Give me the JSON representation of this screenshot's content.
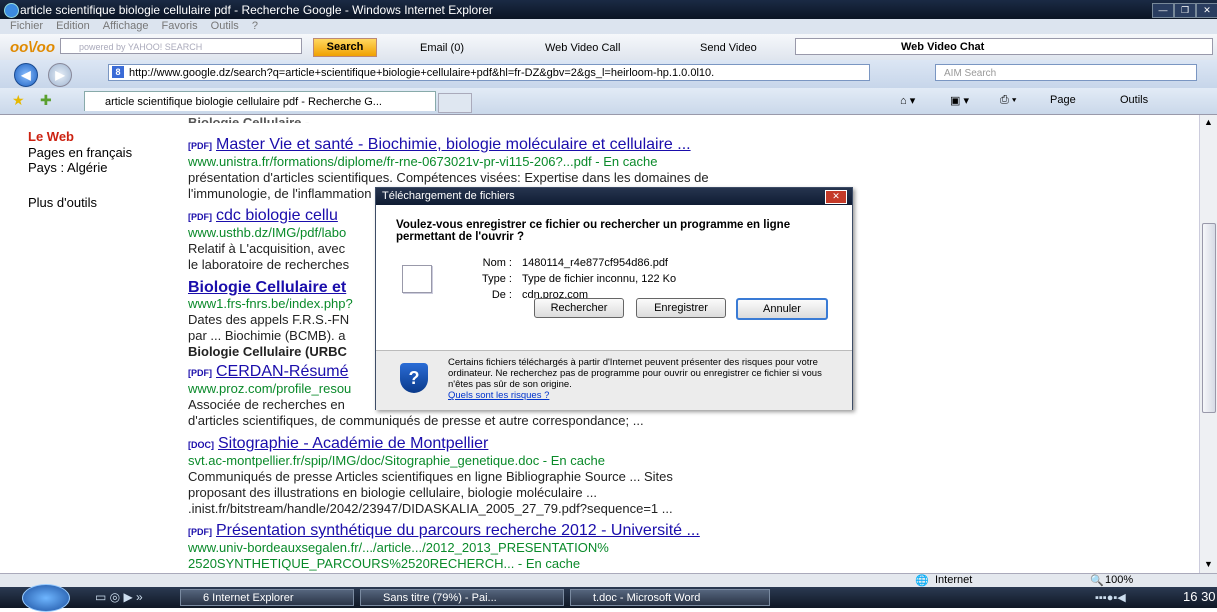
{
  "window": {
    "title": "article scientifique biologie cellulaire pdf - Recherche Google - Windows Internet Explorer"
  },
  "menu": [
    "Fichier",
    "Edition",
    "Affichage",
    "Favoris",
    "Outils",
    "?"
  ],
  "yahoo_toolbar": {
    "logo": "oo\\/oo",
    "search_placeholder": "powered by YAHOO! SEARCH",
    "search_button": "Search",
    "email": "Email (0)",
    "video_call": "Web Video Call",
    "send_video": "Send Video",
    "video_chat": "Web Video Chat"
  },
  "address_bar": {
    "url": "http://www.google.dz/search?q=article+scientifique+biologie+cellulaire+pdf&hl=fr-DZ&gbv=2&gs_l=heirloom-hp.1.0.0l10.",
    "aim_placeholder": "AIM Search"
  },
  "tab": {
    "label": "article scientifique biologie cellulaire pdf - Recherche G..."
  },
  "commands": {
    "page": "Page",
    "tools": "Outils"
  },
  "left_nav": {
    "web": "Le Web",
    "pages_fr": "Pages en français",
    "country": "Pays : Algérie",
    "more_tools": "Plus d'outils"
  },
  "results_top_cut": "Biologie Cellulaire - ... ...",
  "results": [
    {
      "type": "[PDF]",
      "title": "Master Vie et santé - Biochimie, biologie moléculaire et cellulaire ...",
      "url": "www.unistra.fr/formations/diplome/fr-rne-0673021v-pr-vi115-206?...pdf - En cache",
      "snippet": [
        "présentation d'articles scientifiques. Compétences visées: Expertise dans les domaines de",
        "l'immunologie, de l'inflammation et de la biologie cellulaire intégrée ..."
      ]
    },
    {
      "type": "[PDF]",
      "title": "cdc biologie cellu",
      "url": "www.usthb.dz/IMG/pdf/labo",
      "snippet": [
        "Relatif à L'acquisition, avec",
        "le laboratoire de recherches"
      ]
    },
    {
      "type": "",
      "title": "Biologie Cellulaire et",
      "url": "www1.frs-fnrs.be/index.php?",
      "snippet": [
        "Dates des appels F.R.S.-FN",
        "par ... Biochimie (BCMB). a",
        "Biologie Cellulaire (URBC"
      ]
    },
    {
      "type": "[PDF]",
      "title": "CERDAN-Résumé",
      "url": "www.proz.com/profile_resou",
      "snippet": [
        "Associée de recherches en",
        "d'articles scientifiques, de communiqués de presse et autre correspondance; ..."
      ]
    },
    {
      "type": "[DOC]",
      "title": "Sitographie - Académie de Montpellier",
      "url": "svt.ac-montpellier.fr/spip/IMG/doc/Sitographie_genetique.doc - En cache",
      "snippet": [
        "Communiqués de presse Articles scientifiques en ligne Bibliographie Source ... Sites",
        "proposant des illustrations en biologie cellulaire, biologie moléculaire ...",
        ".inist.fr/bitstream/handle/2042/23947/DIDASKALIA_2005_27_79.pdf?sequence=1 ..."
      ]
    },
    {
      "type": "[PDF]",
      "title": "Présentation synthétique du parcours recherche 2012 - Université ...",
      "url": "www.univ-bordeauxsegalen.fr/.../article.../2012_2013_PRESENTATION%",
      "snippet": [
        "2520SYNTHETIQUE_PARCOURS%2520RECHERCH... - En cache"
      ]
    }
  ],
  "dialog": {
    "title": "Téléchargement de fichiers",
    "question": "Voulez-vous enregistrer ce fichier ou rechercher un programme en ligne permettant de l'ouvrir ?",
    "name_label": "Nom :",
    "name_value": "1480114_r4e877cf954d86.pdf",
    "type_label": "Type :",
    "type_value": "Type de fichier inconnu, 122 Ko",
    "from_label": "De :",
    "from_value": "cdn.proz.com",
    "btn_search": "Rechercher",
    "btn_save": "Enregistrer",
    "btn_cancel": "Annuler",
    "warning": "Certains fichiers téléchargés à partir d'Internet peuvent présenter des risques pour votre ordinateur. Ne recherchez pas de programme pour ouvrir ou enregistrer ce fichier si vous n'êtes pas sûr de son origine.",
    "risks_link": "Quels sont les risques ?"
  },
  "status": {
    "zone": "Internet",
    "zoom": "100%"
  },
  "taskbar": {
    "ie": "6 Internet Explorer",
    "paint": "Sans titre (79%) - Pai...",
    "word": "t.doc - Microsoft Word",
    "clock": "16 30"
  }
}
